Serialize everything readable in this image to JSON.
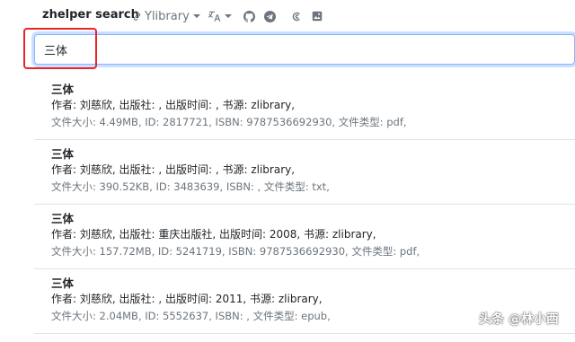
{
  "header": {
    "brand": "zhelper search",
    "library_label": "Ylibrary",
    "icons": [
      "link-icon",
      "translate-icon",
      "github-icon",
      "telegram-icon",
      "opencollective-icon",
      "image-icon"
    ]
  },
  "search": {
    "value": "三体"
  },
  "results": [
    {
      "title": "三体",
      "meta": "作者: 刘慈欣, 出版社: , 出版时间: , 书源: zlibrary,",
      "info": "文件大小:  4.49MB, ID:  2817721, ISBN:  9787536692930, 文件类型:  pdf,"
    },
    {
      "title": "三体",
      "meta": "作者: 刘慈欣, 出版社: , 出版时间: , 书源: zlibrary,",
      "info": "文件大小:  390.52KB, ID:  3483639, ISBN: , 文件类型:  txt,"
    },
    {
      "title": "三体",
      "meta": "作者: 刘慈欣, 出版社: 重庆出版社, 出版时间: 2008, 书源: zlibrary,",
      "info": "文件大小:  157.72MB, ID:  5241719, ISBN:  9787536692930, 文件类型:  pdf,"
    },
    {
      "title": "三体",
      "meta": "作者: 刘慈欣, 出版社: , 出版时间: 2011, 书源: zlibrary,",
      "info": "文件大小:  2.04MB, ID:  5552637, ISBN: , 文件类型:  epub,"
    }
  ],
  "watermark": "头条 @林小西",
  "colors": {
    "accent_focus": "#86b7fe",
    "highlight_box": "#e8262a",
    "muted_text": "#6c757d"
  }
}
